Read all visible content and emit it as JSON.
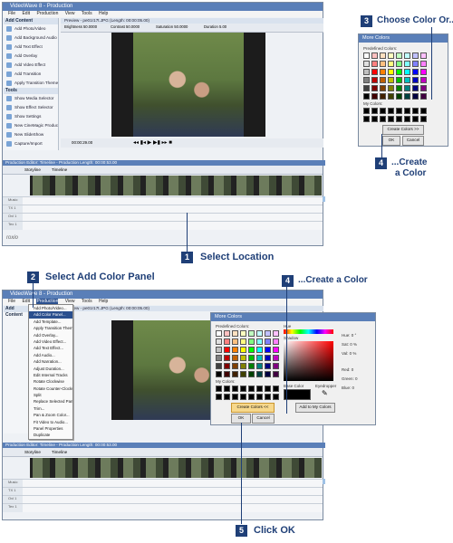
{
  "app": {
    "title": "VideoWave 8 - Production",
    "menu": [
      "File",
      "Edit",
      "Production",
      "View",
      "Tools",
      "Help"
    ],
    "add_content_header": "Add Content",
    "add_content_items": [
      "Add Photo/Video",
      "Add Background Audio",
      "Add Text Effect",
      "Add Overlay",
      "Add Video Effect",
      "Add Transition",
      "Apply Transition Theme"
    ],
    "tools_header": "Tools",
    "tools_items": [
      "Show Media Selector",
      "Show Effect Selector",
      "Show Settings",
      "New CineMagic Production",
      "New SlideShow",
      "Capture/Import"
    ],
    "preview_title": "Preview - pe01r17t.JPG (Length: 00:00:05.00)",
    "controls": {
      "brightness": "Brightness 50.0000",
      "contrast": "Contrast 50.0000",
      "saturation": "Saturation 50.0000",
      "duration": "Duration 5.00"
    },
    "timecode": "00:00:29.00",
    "timeline_title": "Production Editor: Timeline - Production Length: 00:00:53.00",
    "storyline_tab": "Storyline",
    "timeline_tab": "Timeline",
    "audio_caption": "[sailing-sketch-theme] (2570.063) - 09 - Symphony No. 7 in A Major, Op. 92: POCO SOSTENUTO - POCO SOSTENUTO...",
    "track_labels": [
      "Music",
      "TX 1",
      "Ovl 1",
      "Tex 1"
    ],
    "logo": "roxio"
  },
  "top_dialog": {
    "title": "More Colors",
    "predefined_label": "Predefined Colors:",
    "mycolors_label": "My Colors:",
    "create_button": "Create Colors >>",
    "ok": "OK",
    "cancel": "Cancel"
  },
  "bottom_dialog": {
    "title": "More Colors",
    "predefined_label": "Predefined Colors:",
    "mycolors_label": "My Colors:",
    "create_button": "Create Colors <<",
    "ok": "OK",
    "cancel": "Cancel",
    "hue_label": "Hue",
    "sat_label": "Shadow",
    "base_color_label": "Base Color",
    "eyedropper_label": "Eyedropper",
    "hue_value": "Hue:  0 °",
    "sat_value": "Sat:  0 %",
    "val_value": "Val:  0 %",
    "red_value": "Red:  0",
    "green_value": "Green:  0",
    "blue_value": "Blue:  0",
    "add_button": "Add to My Colors"
  },
  "production_menu": {
    "items": [
      "Add Photo/Video...",
      "Add Color Panel...",
      "Add Template...",
      "Apply Transition Theme",
      "Add Overlay...",
      "Add Video Effect...",
      "Add Text Effect...",
      "Add Audio...",
      "Add Narration...",
      "Adjust Duration...",
      "Edit Internal Tracks",
      "Rotate Clockwise",
      "Rotate Counter-Clockwise",
      "Split",
      "Replace Selected Panel...",
      "Trim...",
      "Pan & Zoom Color...",
      "Fit Video to Audio...",
      "Panel Properties",
      "Duplicate"
    ]
  },
  "callouts": {
    "step1": {
      "num": "1",
      "text": "Select Location"
    },
    "step2": {
      "num": "2",
      "text": "Select Add Color Panel"
    },
    "step3": {
      "num": "3",
      "text": "Choose Color Or..."
    },
    "step4a": {
      "num": "4",
      "line1": "...Create",
      "line2": "a Color"
    },
    "step4b": {
      "num": "4",
      "text": "...Create a Color"
    },
    "step5": {
      "num": "5",
      "text": "Click OK"
    }
  },
  "colors": {
    "accent": "#1f3f77",
    "titlebar": "#5a7fb8"
  }
}
